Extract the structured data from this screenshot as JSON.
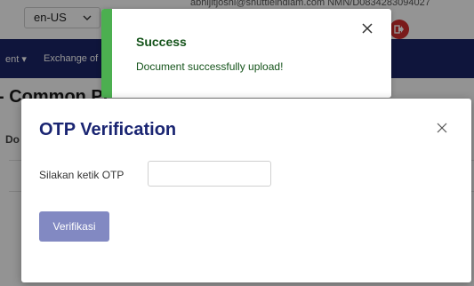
{
  "topbar": {
    "language": "en-US",
    "url_fragment": "abhijitjoshi@shuttleindiam.com  NMN/D0834283094027"
  },
  "navbar": {
    "items": [
      {
        "label": "ent ▾"
      },
      {
        "label": "Exchange of"
      }
    ]
  },
  "background": {
    "page_heading": "- Common Pr",
    "column_fragment": "Do"
  },
  "toast": {
    "title": "Success",
    "message": "Document successfully upload!"
  },
  "modal": {
    "title": "OTP Verification",
    "otp_label": "Silakan ketik OTP",
    "otp_value": "",
    "otp_placeholder": "",
    "verify_button": "Verifikasi"
  },
  "colors": {
    "navbar": "#1b2568",
    "toast_accent": "#4caf50",
    "toast_text": "#14531a",
    "modal_title": "#1a2572",
    "verify_button": "#8289c2",
    "logout": "#d32f2f"
  }
}
